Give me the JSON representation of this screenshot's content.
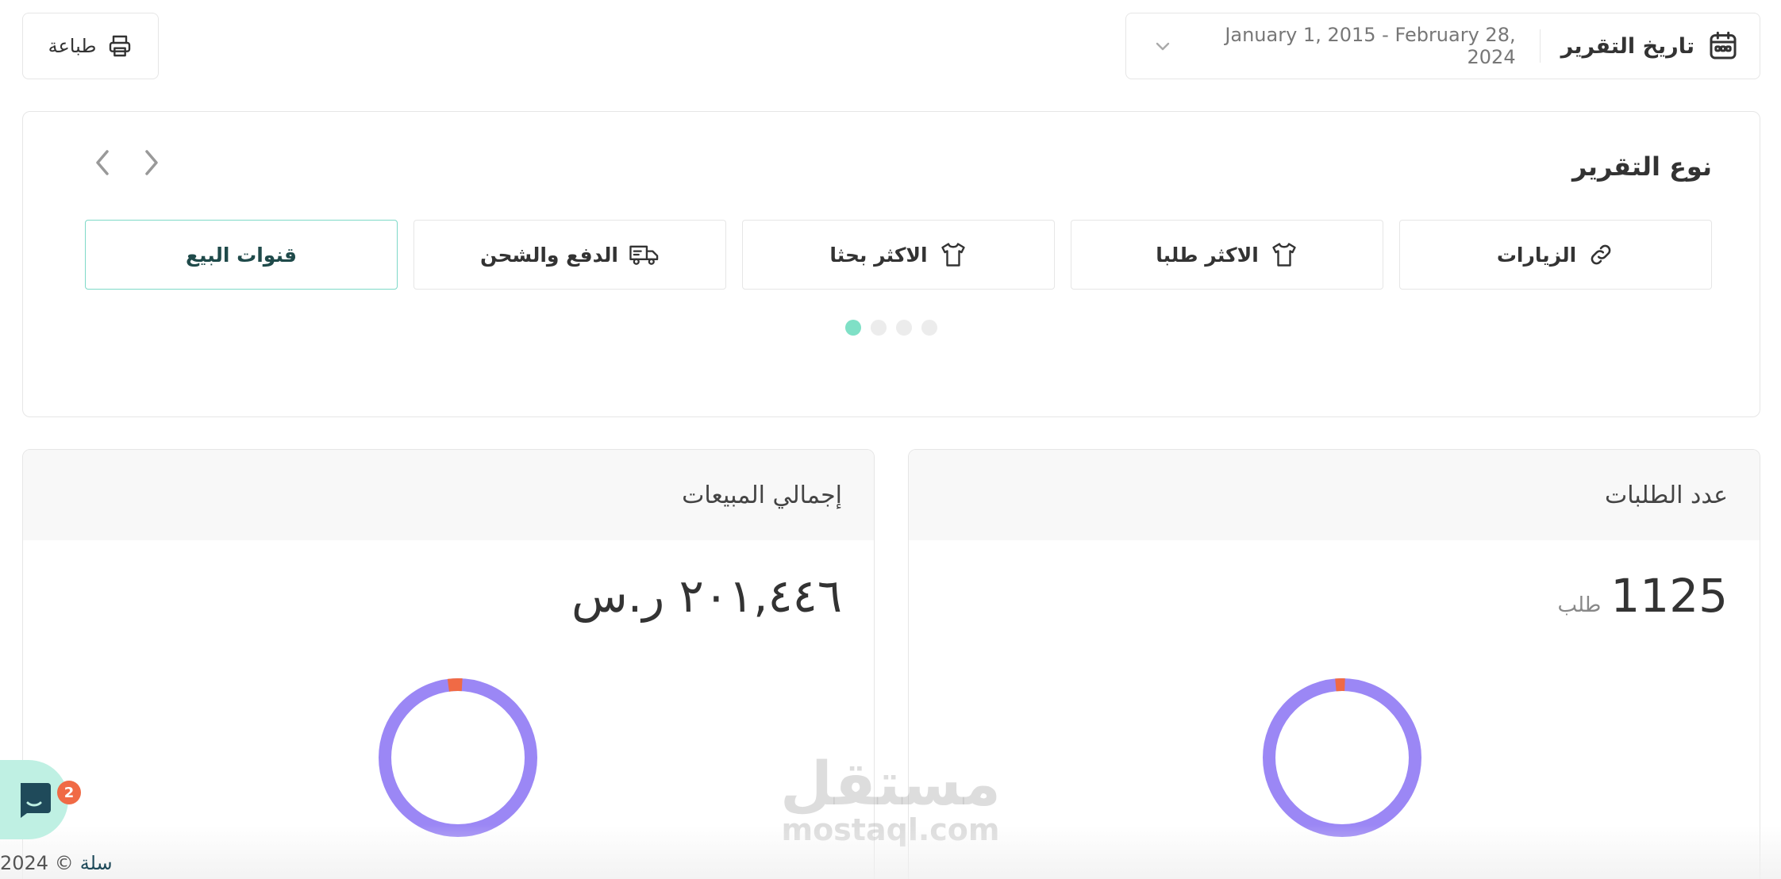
{
  "toolbar": {
    "print_label": "طباعة",
    "report_date_label": "تاريخ التقرير",
    "date_range": "January 1, 2015 - February 28, 2024"
  },
  "report_type": {
    "title": "نوع التقرير",
    "tabs": [
      {
        "label": "الزيارات",
        "icon": "link-icon",
        "active": false
      },
      {
        "label": "الاكثر طلبا",
        "icon": "shirt-icon",
        "active": false
      },
      {
        "label": "الاكثر بحثا",
        "icon": "shirt-icon",
        "active": false
      },
      {
        "label": "الدفع والشحن",
        "icon": "delivery-truck-icon",
        "active": false
      },
      {
        "label": "قنوات البيع",
        "icon": "",
        "active": true
      }
    ],
    "pagination_dots": 4,
    "active_dot": 0
  },
  "orders_card": {
    "title": "عدد الطلبات",
    "value": "1125",
    "unit": "طلب",
    "donut_minor_fraction": 0.02
  },
  "sales_card": {
    "title": "إجمالي المبيعات",
    "value": "٢٠١,٤٤٦ ر.س",
    "donut_minor_fraction": 0.03
  },
  "chat": {
    "badge_count": "2"
  },
  "footer": {
    "brand": "سلة",
    "copyright": "© 2024"
  },
  "watermark": {
    "arabic": "مستقل",
    "latin": "mostaql.com"
  },
  "colors": {
    "accent": "#7fe0c6",
    "donut_main": "#9b87f5",
    "donut_minor": "#f06a45",
    "badge": "#f06a45"
  }
}
